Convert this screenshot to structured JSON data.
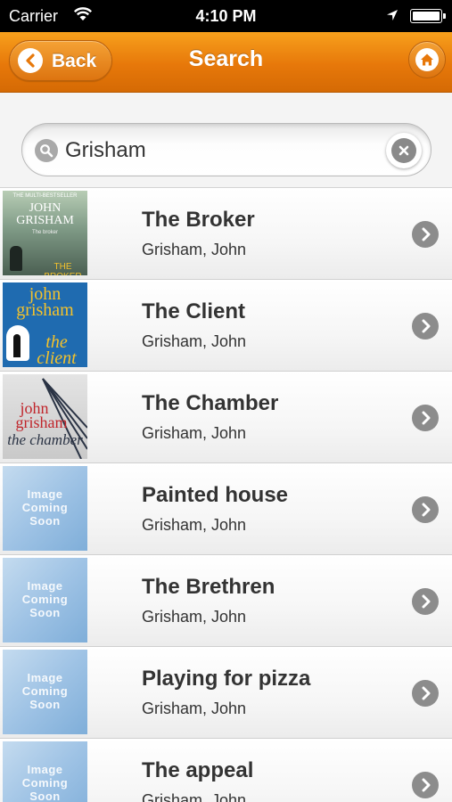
{
  "status_bar": {
    "carrier": "Carrier",
    "time": "4:10 PM"
  },
  "nav": {
    "title": "Search",
    "back_label": "Back",
    "back_icon": "chevron-left-icon",
    "home_icon": "home-icon"
  },
  "search": {
    "value": "Grisham",
    "placeholder": ""
  },
  "books": [
    {
      "title": "The Broker",
      "author": "Grisham, John",
      "cover": "broker"
    },
    {
      "title": "The Client",
      "author": "Grisham, John",
      "cover": "client"
    },
    {
      "title": "The Chamber",
      "author": "Grisham, John",
      "cover": "chamber"
    },
    {
      "title": "Painted house",
      "author": "Grisham, John",
      "cover": "placeholder"
    },
    {
      "title": "The Brethren",
      "author": "Grisham, John",
      "cover": "placeholder"
    },
    {
      "title": "Playing for pizza",
      "author": "Grisham, John",
      "cover": "placeholder"
    },
    {
      "title": "The appeal",
      "author": "Grisham, John",
      "cover": "placeholder"
    }
  ],
  "covers": {
    "broker": {
      "top": "THE MULTI-BESTSELLER",
      "line1": "JOHN",
      "line2": "GRISHAM",
      "tag": "The broker",
      "title": "THE BROKER"
    },
    "client": {
      "line1": "john",
      "line2": "grisham",
      "title": "the client"
    },
    "chamber": {
      "line1": "john",
      "line2": "grisham",
      "title": "the chamber"
    },
    "placeholder": {
      "line1": "Image",
      "line2": "Coming",
      "line3": "Soon"
    }
  },
  "colors": {
    "accent": "#e7780a",
    "nav_dark": "#d56a04"
  }
}
